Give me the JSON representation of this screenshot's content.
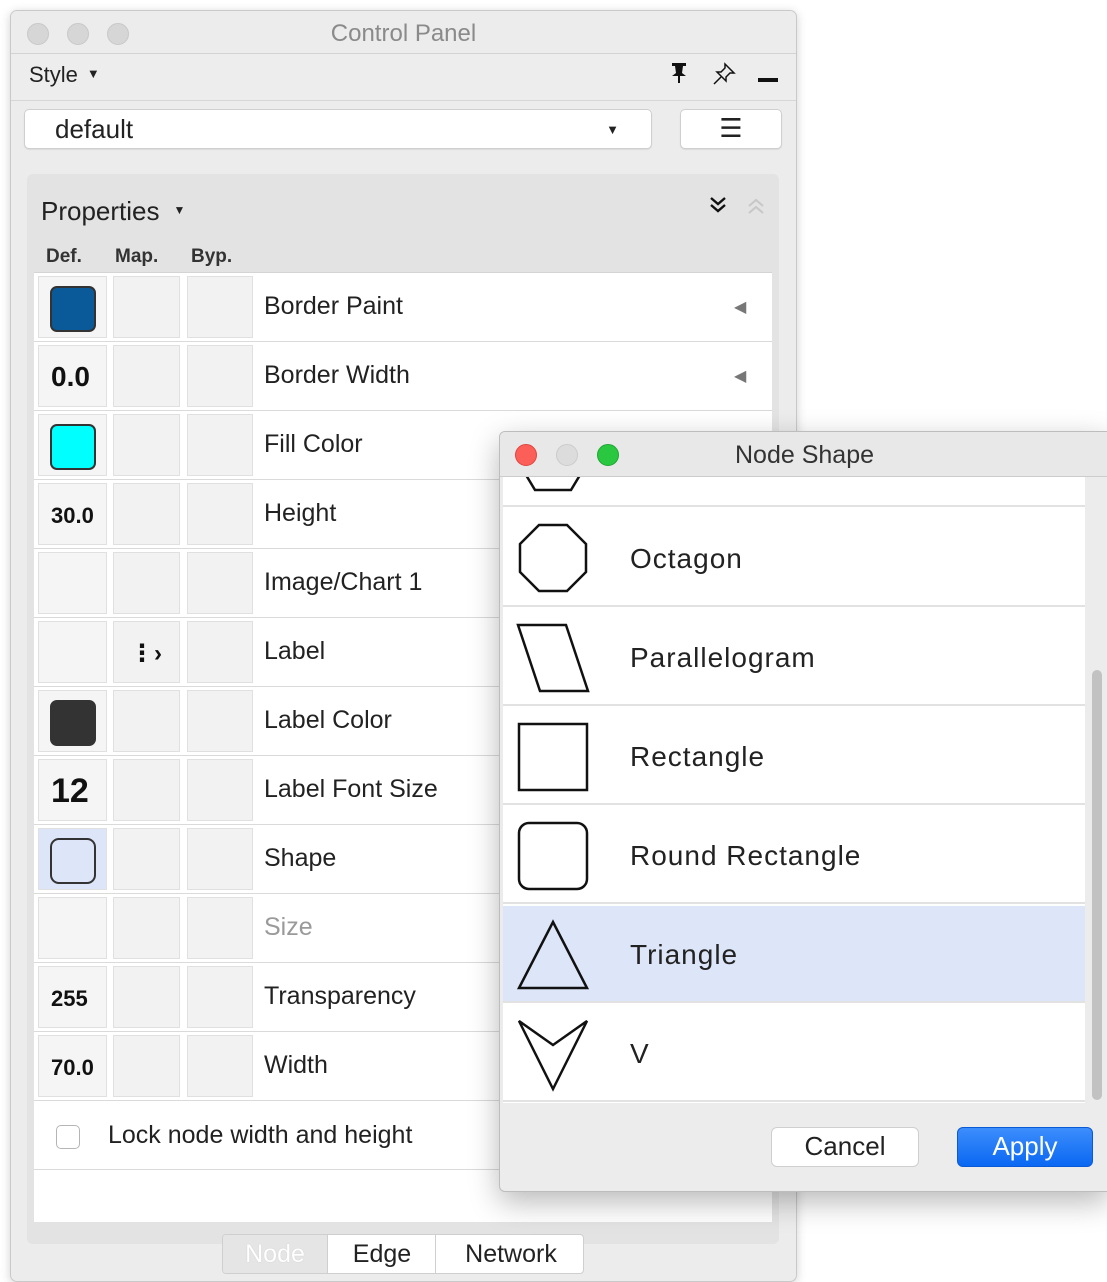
{
  "control_panel": {
    "title": "Control Panel",
    "style_menu_label": "Style",
    "style_combo_value": "default",
    "properties_label": "Properties",
    "columns": [
      "Def.",
      "Map.",
      "Byp."
    ],
    "rows": [
      {
        "label": "Border Paint",
        "def_type": "color",
        "def_color": "#0a5a99",
        "has_arrow": true
      },
      {
        "label": "Border Width",
        "def_type": "number",
        "def_value": "0.0",
        "has_arrow": true
      },
      {
        "label": "Fill Color",
        "def_type": "color",
        "def_color": "#00ffff"
      },
      {
        "label": "Height",
        "def_type": "number",
        "def_value": "30.0"
      },
      {
        "label": "Image/Chart 1",
        "def_type": "empty"
      },
      {
        "label": "Label",
        "def_type": "empty",
        "map_icon": "passthrough-mapping-icon"
      },
      {
        "label": "Label Color",
        "def_type": "color",
        "def_color": "#333333"
      },
      {
        "label": "Label Font Size",
        "def_type": "number-large",
        "def_value": "12"
      },
      {
        "label": "Shape",
        "def_type": "shape",
        "def_color": "#dde6f8"
      },
      {
        "label": "Size",
        "def_type": "empty",
        "disabled": true
      },
      {
        "label": "Transparency",
        "def_type": "number",
        "def_value": "255"
      },
      {
        "label": "Width",
        "def_type": "number",
        "def_value": "70.0"
      }
    ],
    "lock_label": "Lock node width and height",
    "lock_checked": false,
    "tabs": [
      "Node",
      "Edge",
      "Network"
    ],
    "active_tab": "Node"
  },
  "dialog": {
    "title": "Node Shape",
    "shapes": [
      {
        "name": "",
        "icon": "hexagon-icon"
      },
      {
        "name": "Octagon",
        "icon": "octagon-icon"
      },
      {
        "name": "Parallelogram",
        "icon": "parallelogram-icon"
      },
      {
        "name": "Rectangle",
        "icon": "rectangle-icon"
      },
      {
        "name": "Round Rectangle",
        "icon": "round-rectangle-icon"
      },
      {
        "name": "Triangle",
        "icon": "triangle-icon",
        "selected": true
      },
      {
        "name": "V",
        "icon": "v-icon"
      }
    ],
    "cancel_label": "Cancel",
    "apply_label": "Apply",
    "selection_color": "#dde6f8",
    "apply_color": "#0a68f2"
  }
}
